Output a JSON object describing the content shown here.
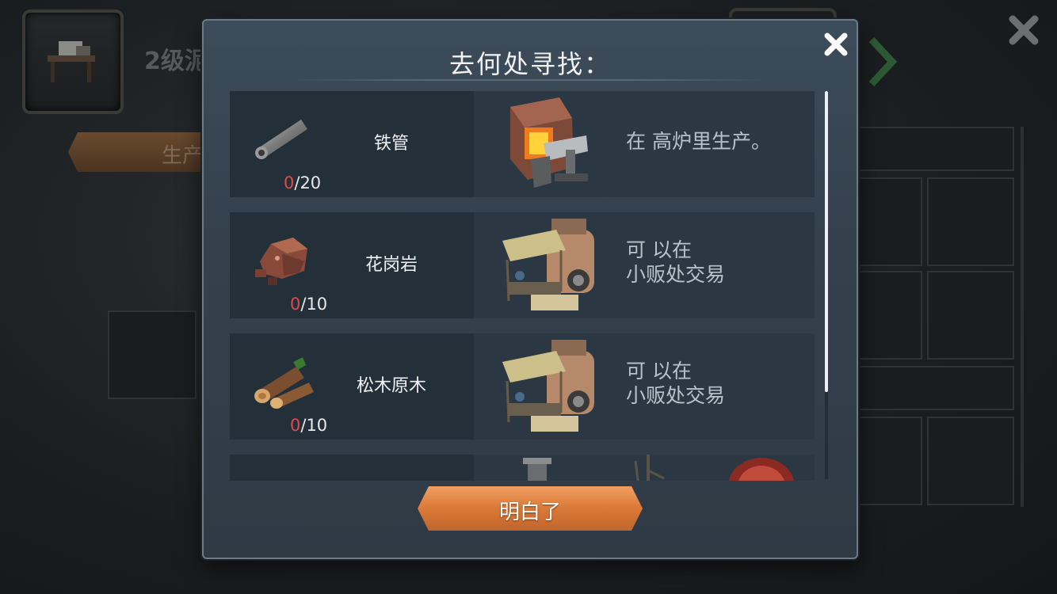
{
  "background": {
    "title": "2级泥",
    "tab_label": "生产"
  },
  "dialog": {
    "title": "去何处寻找：",
    "confirm_label": "明白了",
    "items": [
      {
        "name": "铁管",
        "have": "0",
        "need": "/20",
        "source_lines": [
          "在 高炉里生产。",
          ""
        ],
        "source_icon": "blast-furnace-icon"
      },
      {
        "name": "花岗岩",
        "have": "0",
        "need": "/10",
        "source_lines": [
          "可 以在",
          "小贩处交易"
        ],
        "source_icon": "trader-stall-icon"
      },
      {
        "name": "松木原木",
        "have": "0",
        "need": "/10",
        "source_lines": [
          "可 以在",
          "小贩处交易"
        ],
        "source_icon": "trader-stall-icon"
      }
    ]
  },
  "colors": {
    "accent_orange": "#dd7c3a",
    "count_missing": "#e0484a"
  }
}
